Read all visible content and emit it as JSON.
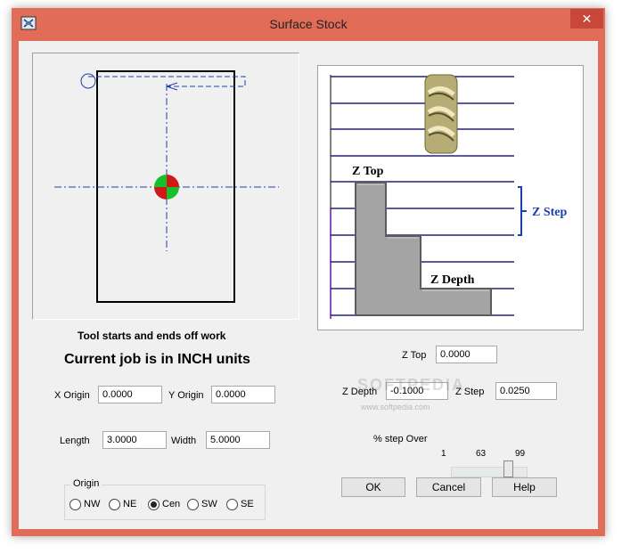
{
  "window": {
    "title": "Surface Stock",
    "close_label": "✕",
    "frame_color": "#e16c57"
  },
  "left_panel": {
    "note": "Tool starts and ends off work",
    "units_message": "Current job is in INCH units",
    "x_origin": {
      "label": "X Origin",
      "value": "0.0000"
    },
    "y_origin": {
      "label": "Y Origin",
      "value": "0.0000"
    },
    "length": {
      "label": "Length",
      "value": "3.0000"
    },
    "width": {
      "label": "Width",
      "value": "5.0000"
    },
    "origin_group": {
      "label": "Origin",
      "options": [
        "NW",
        "NE",
        "Cen",
        "SW",
        "SE"
      ],
      "selected": "Cen"
    }
  },
  "diagram": {
    "z_top_label": "Z Top",
    "z_step_label": "Z Step",
    "z_depth_label": "Z Depth"
  },
  "right_panel": {
    "z_top": {
      "label": "Z Top",
      "value": "0.0000"
    },
    "z_depth": {
      "label": "Z Depth",
      "value": "-0.1000"
    },
    "z_step": {
      "label": "Z Step",
      "value": "0.0250"
    },
    "step_over": {
      "label": "% step Over",
      "min": "1",
      "value": "63",
      "max": "99",
      "level": 0.63
    }
  },
  "buttons": {
    "ok": "OK",
    "cancel": "Cancel",
    "help": "Help"
  },
  "watermark": {
    "big": "SOFTPEDIA",
    "url": "www.softpedia.com"
  },
  "colors": {
    "client_bg": "#f0f0f0",
    "outline_blue": "#1f3fa6",
    "step_blue": "#1a3fb0"
  }
}
